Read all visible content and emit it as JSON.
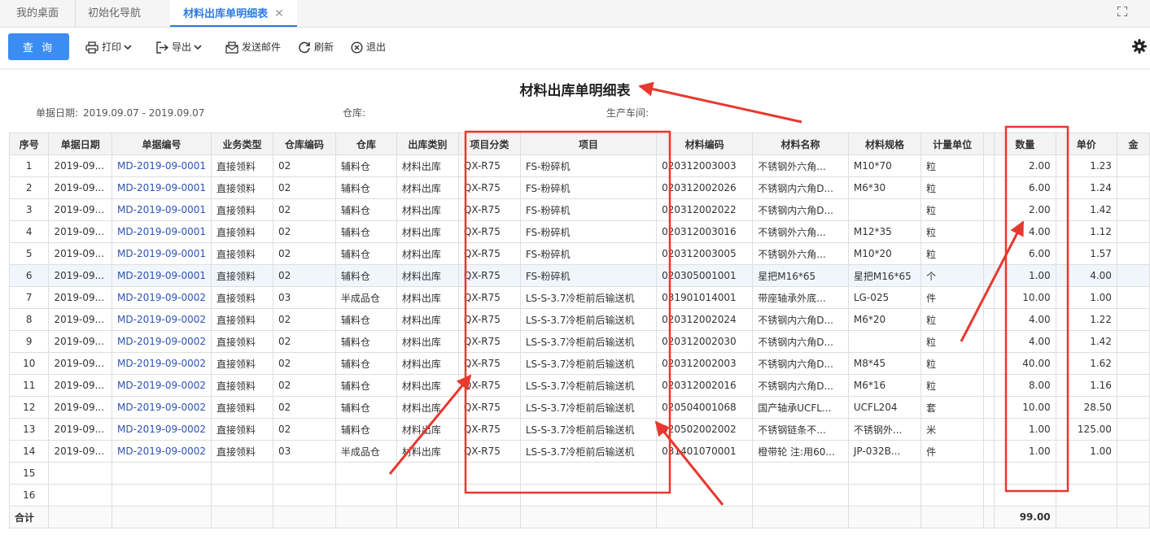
{
  "tabs": [
    {
      "label": "我的桌面"
    },
    {
      "label": "初始化导航"
    },
    {
      "label": "材料出库单明细表"
    }
  ],
  "toolbar": {
    "query_label": "查 询",
    "print_label": "打印",
    "export_label": "导出",
    "email_label": "发送邮件",
    "refresh_label": "刷新",
    "exit_label": "退出"
  },
  "report": {
    "title": "材料出库单明细表",
    "date_label": "单据日期:",
    "date_value": "2019.09.07 - 2019.09.07",
    "warehouse_label": "仓库:",
    "workshop_label": "生产车间:"
  },
  "table": {
    "headers": [
      "序号",
      "单据日期",
      "单据编号",
      "业务类型",
      "仓库编码",
      "仓库",
      "出库类别",
      "项目分类",
      "项目",
      "材料编码",
      "材料名称",
      "材料规格",
      "计量单位",
      "",
      "数量",
      "单价",
      "金"
    ],
    "rows": [
      [
        "1",
        "2019-09...",
        "MD-2019-09-0001",
        "直接领料",
        "02",
        "辅料仓",
        "材料出库",
        "QX-R75",
        "FS-粉碎机",
        "020312003003",
        "不锈钢外六角...",
        "M10*70",
        "粒",
        "",
        "2.00",
        "1.23",
        ""
      ],
      [
        "2",
        "2019-09...",
        "MD-2019-09-0001",
        "直接领料",
        "02",
        "辅料仓",
        "材料出库",
        "QX-R75",
        "FS-粉碎机",
        "020312002026",
        "不锈钢内六角D...",
        "M6*30",
        "粒",
        "",
        "6.00",
        "1.24",
        ""
      ],
      [
        "3",
        "2019-09...",
        "MD-2019-09-0001",
        "直接领料",
        "02",
        "辅料仓",
        "材料出库",
        "QX-R75",
        "FS-粉碎机",
        "020312002022",
        "不锈钢内六角D...",
        "",
        "粒",
        "",
        "2.00",
        "1.42",
        ""
      ],
      [
        "4",
        "2019-09...",
        "MD-2019-09-0001",
        "直接领料",
        "02",
        "辅料仓",
        "材料出库",
        "QX-R75",
        "FS-粉碎机",
        "020312003016",
        "不锈钢外六角...",
        "M12*35",
        "粒",
        "",
        "4.00",
        "1.12",
        ""
      ],
      [
        "5",
        "2019-09...",
        "MD-2019-09-0001",
        "直接领料",
        "02",
        "辅料仓",
        "材料出库",
        "QX-R75",
        "FS-粉碎机",
        "020312003005",
        "不锈钢外六角...",
        "M10*20",
        "粒",
        "",
        "6.00",
        "1.57",
        ""
      ],
      [
        "6",
        "2019-09...",
        "MD-2019-09-0001",
        "直接领料",
        "02",
        "辅料仓",
        "材料出库",
        "QX-R75",
        "FS-粉碎机",
        "020305001001",
        "星把M16*65",
        "星把M16*65",
        "个",
        "",
        "1.00",
        "4.00",
        ""
      ],
      [
        "7",
        "2019-09...",
        "MD-2019-09-0002",
        "直接领料",
        "03",
        "半成品仓",
        "材料出库",
        "QX-R75",
        "LS-S-3.7冷柜前后输送机",
        "031901014001",
        "带座轴承外底...",
        "LG-025",
        "件",
        "",
        "10.00",
        "1.00",
        ""
      ],
      [
        "8",
        "2019-09...",
        "MD-2019-09-0002",
        "直接领料",
        "02",
        "辅料仓",
        "材料出库",
        "QX-R75",
        "LS-S-3.7冷柜前后输送机",
        "020312002024",
        "不锈钢内六角D...",
        "M6*20",
        "粒",
        "",
        "4.00",
        "1.22",
        ""
      ],
      [
        "9",
        "2019-09...",
        "MD-2019-09-0002",
        "直接领料",
        "02",
        "辅料仓",
        "材料出库",
        "QX-R75",
        "LS-S-3.7冷柜前后输送机",
        "020312002030",
        "不锈钢内六角D...",
        "",
        "粒",
        "",
        "4.00",
        "1.42",
        ""
      ],
      [
        "10",
        "2019-09...",
        "MD-2019-09-0002",
        "直接领料",
        "02",
        "辅料仓",
        "材料出库",
        "QX-R75",
        "LS-S-3.7冷柜前后输送机",
        "020312002003",
        "不锈钢内六角D...",
        "M8*45",
        "粒",
        "",
        "40.00",
        "1.62",
        ""
      ],
      [
        "11",
        "2019-09...",
        "MD-2019-09-0002",
        "直接领料",
        "02",
        "辅料仓",
        "材料出库",
        "QX-R75",
        "LS-S-3.7冷柜前后输送机",
        "020312002016",
        "不锈钢内六角D...",
        "M6*16",
        "粒",
        "",
        "8.00",
        "1.16",
        ""
      ],
      [
        "12",
        "2019-09...",
        "MD-2019-09-0002",
        "直接领料",
        "02",
        "辅料仓",
        "材料出库",
        "QX-R75",
        "LS-S-3.7冷柜前后输送机",
        "020504001068",
        "国产轴承UCFL...",
        "UCFL204",
        "套",
        "",
        "10.00",
        "28.50",
        ""
      ],
      [
        "13",
        "2019-09...",
        "MD-2019-09-0002",
        "直接领料",
        "02",
        "辅料仓",
        "材料出库",
        "QX-R75",
        "LS-S-3.7冷柜前后输送机",
        "020502002002",
        "不锈钢链条不...",
        "不锈钢外...",
        "米",
        "",
        "1.00",
        "125.00",
        ""
      ],
      [
        "14",
        "2019-09...",
        "MD-2019-09-0002",
        "直接领料",
        "03",
        "半成品仓",
        "材料出库",
        "QX-R75",
        "LS-S-3.7冷柜前后输送机",
        "031401070001",
        "橙带轮 注:用60...",
        "JP-032B...",
        "件",
        "",
        "1.00",
        "1.00",
        ""
      ],
      [
        "15",
        "",
        "",
        "",
        "",
        "",
        "",
        "",
        "",
        "",
        "",
        "",
        "",
        "",
        "",
        "",
        ""
      ],
      [
        "16",
        "",
        "",
        "",
        "",
        "",
        "",
        "",
        "",
        "",
        "",
        "",
        "",
        "",
        "",
        "",
        ""
      ]
    ],
    "total": {
      "label": "合计",
      "quantity": "99.00"
    }
  },
  "colors": {
    "primary": "#3c8df2",
    "active_tab": "#2d7be5",
    "link": "#2c53b7",
    "annotation": "#e8382f"
  }
}
